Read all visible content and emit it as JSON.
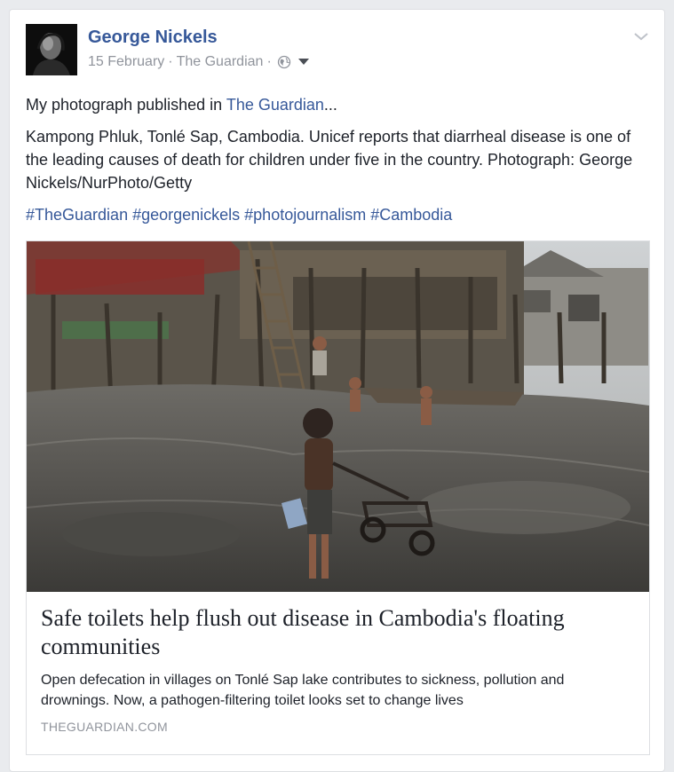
{
  "post": {
    "author": "George Nickels",
    "date": "15 February",
    "meta_sep1": "·",
    "source": "The Guardian",
    "meta_sep2": "·",
    "audience_icon": "globe-icon",
    "options_icon": "chevron-down-icon",
    "intro_text": "My photograph published in ",
    "intro_link": "The Guardian",
    "intro_suffix": "...",
    "caption": "Kampong Phluk, Tonlé Sap, Cambodia. Unicef reports that diarrheal disease is one of the leading causes of death for children under five in the country. Photograph: George Nickels/NurPhoto/Getty",
    "hashtags": [
      "#TheGuardian",
      "#georgenickels",
      "#photojournalism",
      "#Cambodia"
    ]
  },
  "attachment": {
    "title": "Safe toilets help flush out disease in Cambodia's floating communities",
    "description": "Open defecation in villages on Tonlé Sap lake contributes to sickness, pollution and drownings. Now, a pathogen-filtering toilet looks set to change lives",
    "domain": "THEGUARDIAN.COM"
  },
  "colors": {
    "link": "#365899",
    "text": "#1d2129",
    "meta": "#90949c",
    "background": "#e9ebee"
  }
}
